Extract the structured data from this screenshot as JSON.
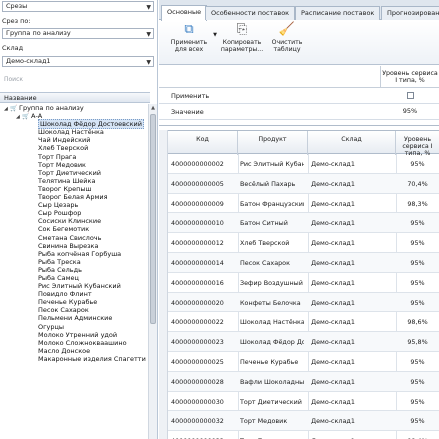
{
  "left": {
    "slices_label": "Срезы",
    "slice_by_label": "Срез по:",
    "slice_by_value": "Группа по анализу",
    "warehouse_label": "Склад",
    "warehouse_value": "Демо-склад1",
    "search_placeholder": "Поиск",
    "tree_header": "Название",
    "tree_root": "Группа по анализу",
    "tree_group": "А-А",
    "tree_items": [
      "Шоколад Фёдор Достоевский",
      "Шоколад Настёнка",
      "Чай Индейский",
      "Хлеб Тверской",
      "Торт Прага",
      "Торт Медовик",
      "Торт Диетический",
      "Телятина Шейка",
      "Творог Крепыш",
      "Творог Белая Армия",
      "Сыр Цезарь",
      "Сыр Рошфор",
      "Сосиски Клинские",
      "Сок Бегемотик",
      "Сметана Свислочь",
      "Свинина Вырезка",
      "Рыба копчёная Горбуша",
      "Рыба Треска",
      "Рыба Сельдь",
      "Рыба Самец",
      "Рис Элитный Кубанский",
      "Повидло Флинт",
      "Печенье Курабье",
      "Песок Сахарок",
      "Пельмени Админские",
      "Огурцы",
      "Молоко Утренний удой",
      "Молоко Сложнокваашино",
      "Масло Донское",
      "Макаронные изделия Спагетти"
    ]
  },
  "tabs": [
    "Основные",
    "Особенности поставок",
    "Расписание поставок",
    "Прогнозирование"
  ],
  "ribbon": {
    "apply_all": "Применить для всех",
    "copy_params": "Копировать параметры...",
    "clear_table": "Очистить таблицу"
  },
  "top_grid": {
    "col_header": "Уровень сервиса I типа, %",
    "row_apply": "Применить",
    "row_value": "Значение",
    "value": "95%"
  },
  "grid": {
    "headers": {
      "code": "Код",
      "product": "Продукт",
      "warehouse": "Склад",
      "service": "Уровень сервиса I типа, %"
    },
    "rows": [
      {
        "code": "4000000000002",
        "product": "Рис Элитный Кубан...",
        "wh": "Демо-склад1",
        "pct": "95%"
      },
      {
        "code": "4000000000005",
        "product": "Весёлый Пахарь",
        "wh": "Демо-склад1",
        "pct": "70,4%"
      },
      {
        "code": "4000000000009",
        "product": "Батон Французский",
        "wh": "Демо-склад1",
        "pct": "98,3%"
      },
      {
        "code": "4000000000010",
        "product": "Батон Ситный",
        "wh": "Демо-склад1",
        "pct": "95%"
      },
      {
        "code": "4000000000012",
        "product": "Хлеб Тверской",
        "wh": "Демо-склад1",
        "pct": "95%"
      },
      {
        "code": "4000000000014",
        "product": "Песок Сахарок",
        "wh": "Демо-склад1",
        "pct": "95%"
      },
      {
        "code": "4000000000016",
        "product": "Зефир Воздушный",
        "wh": "Демо-склад1",
        "pct": "95%"
      },
      {
        "code": "4000000000020",
        "product": "Конфеты Белочка",
        "wh": "Демо-склад1",
        "pct": "95%"
      },
      {
        "code": "4000000000022",
        "product": "Шоколад Настёнка",
        "wh": "Демо-склад1",
        "pct": "98,6%"
      },
      {
        "code": "4000000000023",
        "product": "Шоколад Фёдор До...",
        "wh": "Демо-склад1",
        "pct": "95,8%"
      },
      {
        "code": "4000000000025",
        "product": "Печенье Курабье",
        "wh": "Демо-склад1",
        "pct": "95%"
      },
      {
        "code": "4000000000028",
        "product": "Вафли Шоколадные",
        "wh": "Демо-склад1",
        "pct": "95%"
      },
      {
        "code": "4000000000030",
        "product": "Торт Диетический",
        "wh": "Демо-склад1",
        "pct": "95%"
      },
      {
        "code": "4000000000032",
        "product": "Торт Медовик",
        "wh": "Демо-склад1",
        "pct": "95%"
      },
      {
        "code": "4000000000033",
        "product": "Торт Прага",
        "wh": "Демо-склад1",
        "pct": "98,4%"
      }
    ]
  }
}
